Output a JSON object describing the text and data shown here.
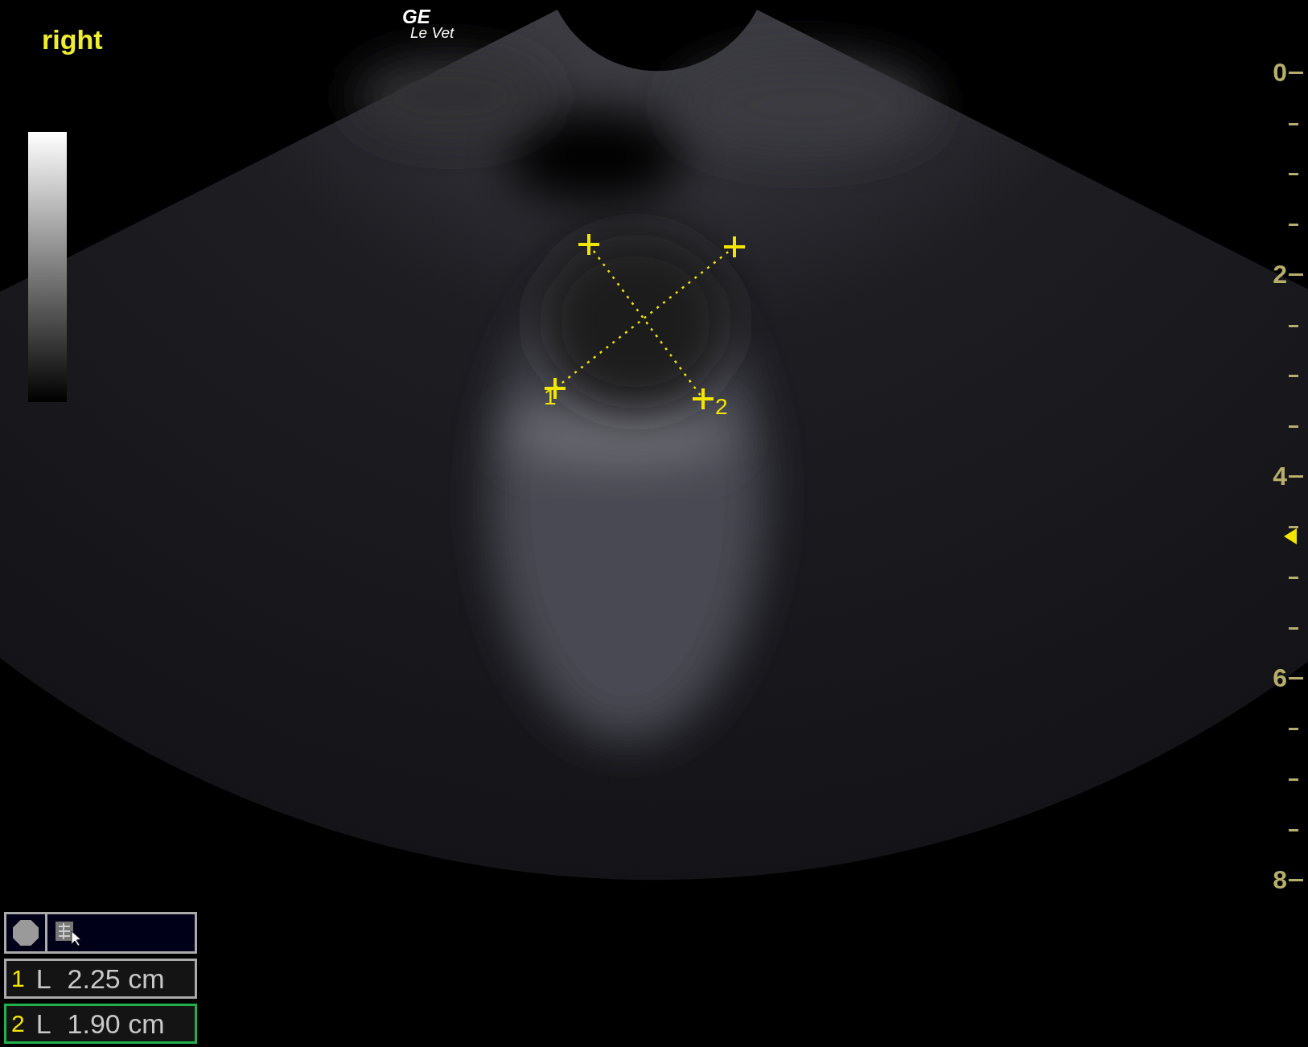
{
  "orientation_label": "right",
  "logo": {
    "line_1": "GE",
    "line_2": "Le Vet"
  },
  "image": {
    "calipers": [
      {
        "label": "1"
      },
      {
        "label": "2"
      }
    ]
  },
  "depth_scale": {
    "labels": [
      "0",
      "2",
      "4",
      "6",
      "8"
    ]
  },
  "measurements": [
    {
      "index": "1",
      "type": "L",
      "value": "2.25 cm",
      "selected": false
    },
    {
      "index": "2",
      "type": "L",
      "value": "1.90 cm",
      "selected": true
    }
  ]
}
